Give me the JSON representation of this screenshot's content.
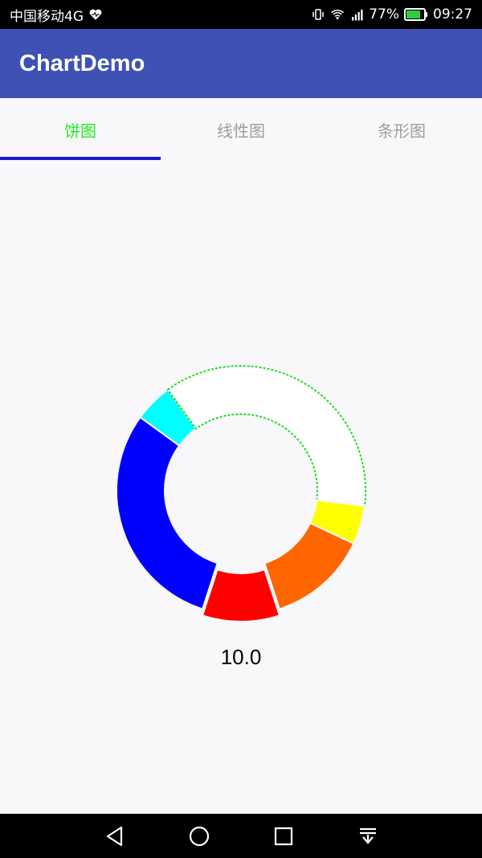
{
  "status_bar": {
    "carrier": "中国移动4G",
    "battery": "77%",
    "time": "09:27",
    "icons": [
      "heart-monitor-icon",
      "vibrate-icon",
      "wifi-icon",
      "signal-4g-icon",
      "battery-icon"
    ]
  },
  "app_bar": {
    "title": "ChartDemo"
  },
  "tabs": [
    {
      "label": "饼图",
      "active": true
    },
    {
      "label": "线性图",
      "active": false
    },
    {
      "label": "条形图",
      "active": false
    }
  ],
  "chart_data": {
    "type": "pie",
    "style": "donut",
    "center_label": "10.0",
    "slices": [
      {
        "color": "#FF0000",
        "value": 10,
        "exploded": true
      },
      {
        "color": "#0000FF",
        "value": 30
      },
      {
        "color": "#00FFFF",
        "value": 5
      },
      {
        "color": "#FFFFFF",
        "value": 37
      },
      {
        "color": "#FFFF00",
        "value": 5
      },
      {
        "color": "#FF6600",
        "value": 13
      }
    ]
  },
  "nav_bar": {
    "icons": [
      "back-icon",
      "home-icon",
      "recents-icon",
      "notification-pulldown-icon"
    ]
  }
}
